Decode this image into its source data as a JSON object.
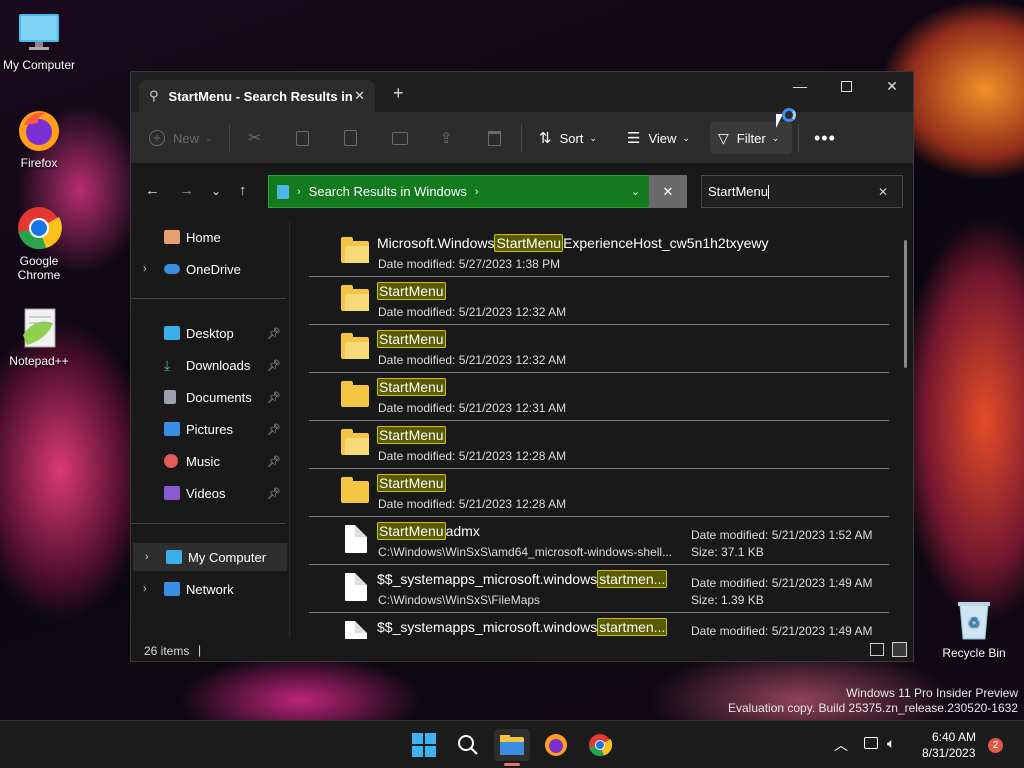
{
  "desktop": {
    "icons": [
      {
        "label": "My Computer"
      },
      {
        "label": "Firefox"
      },
      {
        "label": "Google Chrome"
      },
      {
        "label": "Notepad++"
      },
      {
        "label": "Recycle Bin"
      }
    ],
    "watermark_line1": "Windows 11 Pro Insider Preview",
    "watermark_line2": "Evaluation copy. Build 25375.zn_release.230520-1632"
  },
  "window": {
    "tab_title": "StartMenu - Search Results in",
    "toolbar": {
      "new": "New",
      "sort": "Sort",
      "view": "View",
      "filter": "Filter"
    },
    "address": {
      "path": "Search Results in Windows"
    },
    "search": {
      "value": "StartMenu"
    },
    "sidebar": {
      "items": [
        {
          "label": "Home"
        },
        {
          "label": "OneDrive"
        },
        {
          "label": "Desktop"
        },
        {
          "label": "Downloads"
        },
        {
          "label": "Documents"
        },
        {
          "label": "Pictures"
        },
        {
          "label": "Music"
        },
        {
          "label": "Videos"
        },
        {
          "label": "My Computer"
        },
        {
          "label": "Network"
        }
      ]
    },
    "results": [
      {
        "pre": "Microsoft.Windows",
        "hl": "StartMenu",
        "post": "ExperienceHost_cw5n1h2txyewy",
        "meta_label": "Date modified:",
        "meta_value": "5/27/2023 1:38 PM"
      },
      {
        "pre": "",
        "hl": "StartMenu",
        "post": "",
        "meta_label": "Date modified:",
        "meta_value": "5/21/2023 12:32 AM"
      },
      {
        "pre": "",
        "hl": "StartMenu",
        "post": "",
        "meta_label": "Date modified:",
        "meta_value": "5/21/2023 12:32 AM"
      },
      {
        "pre": "",
        "hl": "StartMenu",
        "post": "",
        "meta_label": "Date modified:",
        "meta_value": "5/21/2023 12:31 AM"
      },
      {
        "pre": "",
        "hl": "StartMenu",
        "post": "",
        "meta_label": "Date modified:",
        "meta_value": "5/21/2023 12:28 AM"
      },
      {
        "pre": "",
        "hl": "StartMenu",
        "post": "",
        "meta_label": "Date modified:",
        "meta_value": "5/21/2023 12:28 AM"
      },
      {
        "pre": "",
        "hl": "StartMenu",
        "post": "admx",
        "path": "C:\\Windows\\WinSxS\\amd64_microsoft-windows-shell...",
        "date_label": "Date modified:",
        "date_value": "5/21/2023 1:52 AM",
        "size_label": "Size:",
        "size_value": "37.1 KB"
      },
      {
        "pre": "$$_systemapps_microsoft.windows",
        "hl": "startmen...",
        "post": "",
        "path": "C:\\Windows\\WinSxS\\FileMaps",
        "date_label": "Date modified:",
        "date_value": "5/21/2023 1:49 AM",
        "size_label": "Size:",
        "size_value": "1.39 KB"
      },
      {
        "pre": "$$_systemapps_microsoft.windows",
        "hl": "startmen...",
        "post": "",
        "path": "",
        "date_label": "Date modified:",
        "date_value": "5/21/2023 1:49 AM",
        "size_label": "",
        "size_value": ""
      }
    ],
    "status": {
      "count": "26 items"
    }
  },
  "taskbar": {
    "time": "6:40 AM",
    "date": "8/31/2023",
    "notification_count": "2"
  }
}
